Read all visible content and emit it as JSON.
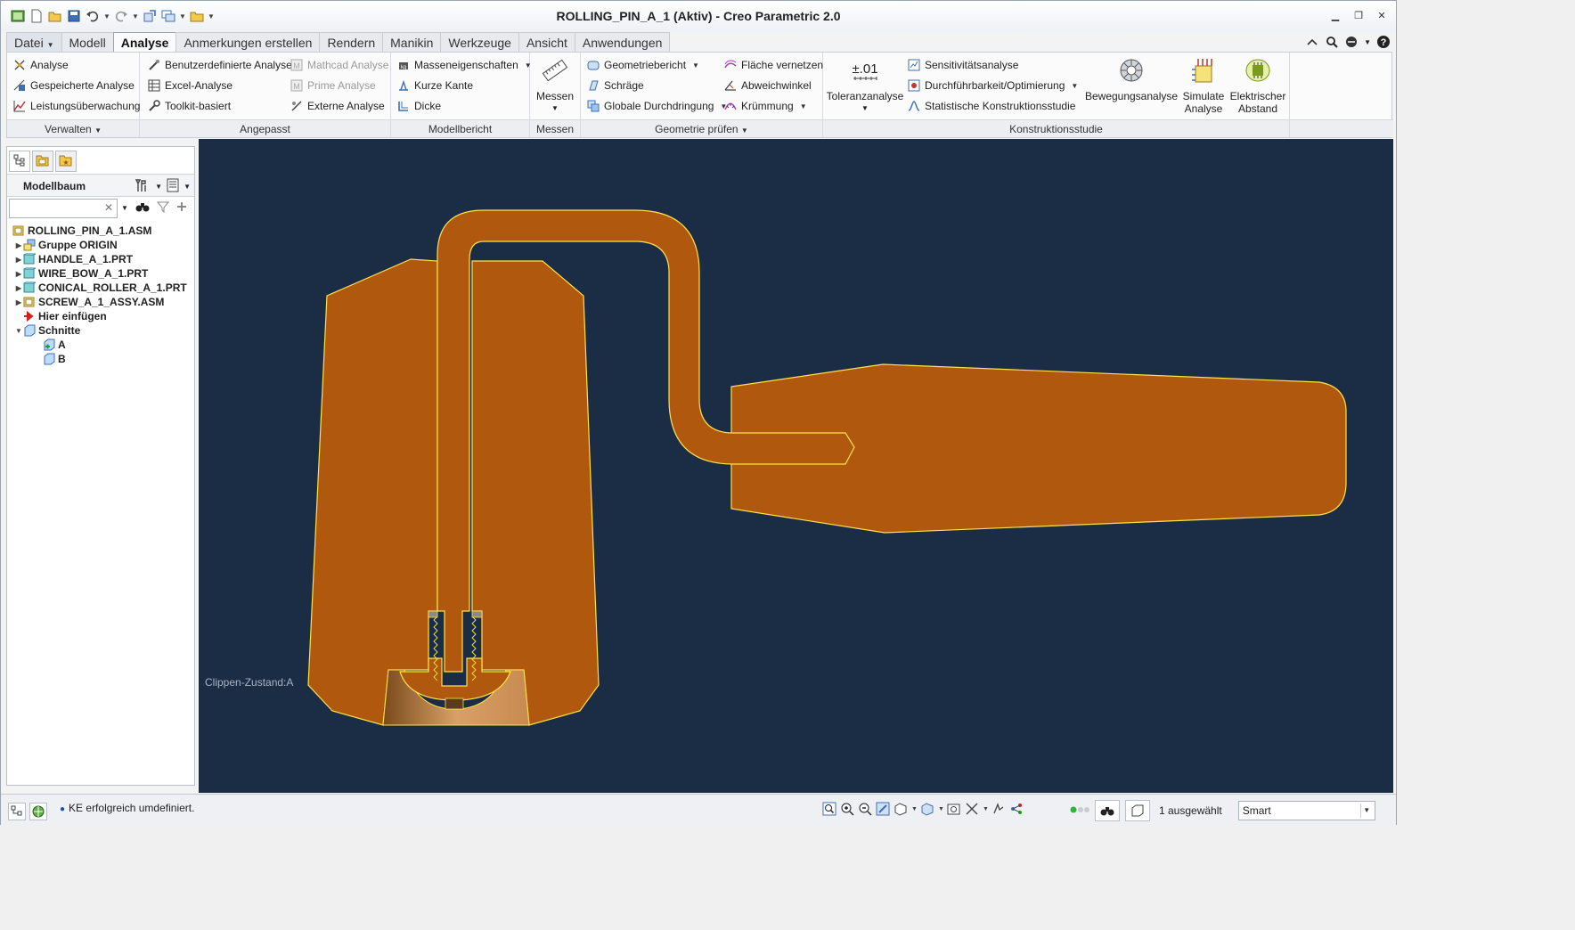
{
  "window": {
    "title": "ROLLING_PIN_A_1 (Aktiv) - Creo Parametric 2.0",
    "controls": [
      "minimize-icon",
      "maximize-icon",
      "close-icon"
    ]
  },
  "quick_access": [
    "new-file-icon",
    "open-icon",
    "save-icon",
    "undo-icon",
    "redo-icon",
    "regenerate-icon",
    "windows-icon",
    "close-window-icon"
  ],
  "tabs": [
    {
      "label": "Datei",
      "has_dropdown": true
    },
    {
      "label": "Modell"
    },
    {
      "label": "Analyse",
      "active": true
    },
    {
      "label": "Anmerkungen erstellen"
    },
    {
      "label": "Rendern"
    },
    {
      "label": "Manikin"
    },
    {
      "label": "Werkzeuge"
    },
    {
      "label": "Ansicht"
    },
    {
      "label": "Anwendungen"
    }
  ],
  "ribbon": {
    "verwalten": {
      "label": "Verwalten",
      "items": [
        "Analyse",
        "Gespeicherte Analyse",
        "Leistungsüberwachung"
      ]
    },
    "angepasst": {
      "label": "Angepasst",
      "col1": [
        "Benutzerdefinierte Analyse",
        "Excel-Analyse",
        "Toolkit-basiert"
      ],
      "col2": [
        "Mathcad Analyse",
        "Prime Analyse",
        "Externe Analyse"
      ]
    },
    "modellbericht": {
      "label": "Modellbericht",
      "items": [
        "Masseneigenschaften",
        "Kurze Kante",
        "Dicke"
      ]
    },
    "messen": {
      "label": "Messen",
      "button": "Messen"
    },
    "geometrie": {
      "label": "Geometrie prüfen",
      "col1": [
        "Geometriebericht",
        "Schräge",
        "Globale Durchdringung"
      ],
      "col2": [
        "Fläche vernetzen",
        "Abweichwinkel",
        "Krümmung"
      ]
    },
    "konstruktion": {
      "label": "Konstruktionsstudie",
      "toleranz": "Toleranzanalyse",
      "toleranz_value": "±.01",
      "items": [
        "Sensitivitätsanalyse",
        "Durchführbarkeit/Optimierung",
        "Statistische Konstruktionsstudie"
      ],
      "bewegung": "Bewegungsanalyse",
      "simulate": [
        "Simulate",
        "Analyse"
      ],
      "elektrisch": [
        "Elektrischer",
        "Abstand"
      ]
    }
  },
  "model_tree": {
    "title": "Modellbaum",
    "search": {
      "value": "",
      "placeholder": ""
    },
    "items": [
      {
        "label": "ROLLING_PIN_A_1.ASM",
        "level": 0,
        "arrow": "",
        "icon": "assembly-icon"
      },
      {
        "label": "Gruppe ORIGIN",
        "level": 1,
        "arrow": "▶",
        "icon": "group-icon"
      },
      {
        "label": "HANDLE_A_1.PRT",
        "level": 1,
        "arrow": "▶",
        "icon": "part-icon"
      },
      {
        "label": "WIRE_BOW_A_1.PRT",
        "level": 1,
        "arrow": "▶",
        "icon": "part-icon"
      },
      {
        "label": "CONICAL_ROLLER_A_1.PRT",
        "level": 1,
        "arrow": "▶",
        "icon": "part-icon"
      },
      {
        "label": "SCREW_A_1_ASSY.ASM",
        "level": 1,
        "arrow": "▶",
        "icon": "assembly-icon"
      },
      {
        "label": "Hier einfügen",
        "level": 1,
        "arrow": "",
        "icon": "insert-here-icon"
      },
      {
        "label": "Schnitte",
        "level": 1,
        "arrow": "▼",
        "icon": "sections-icon"
      },
      {
        "label": "A",
        "level": 2,
        "arrow": "",
        "icon": "section-active-icon"
      },
      {
        "label": "B",
        "level": 2,
        "arrow": "",
        "icon": "section-icon"
      }
    ]
  },
  "viewport": {
    "clip_state": "Clippen-Zustand:A",
    "background": "#1b2c45",
    "part_color": "#b1580f",
    "edge_color": "#ffe24a"
  },
  "status": {
    "message": "KE erfolgreich umdefiniert.",
    "selection": "1 ausgewählt",
    "filter": "Smart"
  }
}
